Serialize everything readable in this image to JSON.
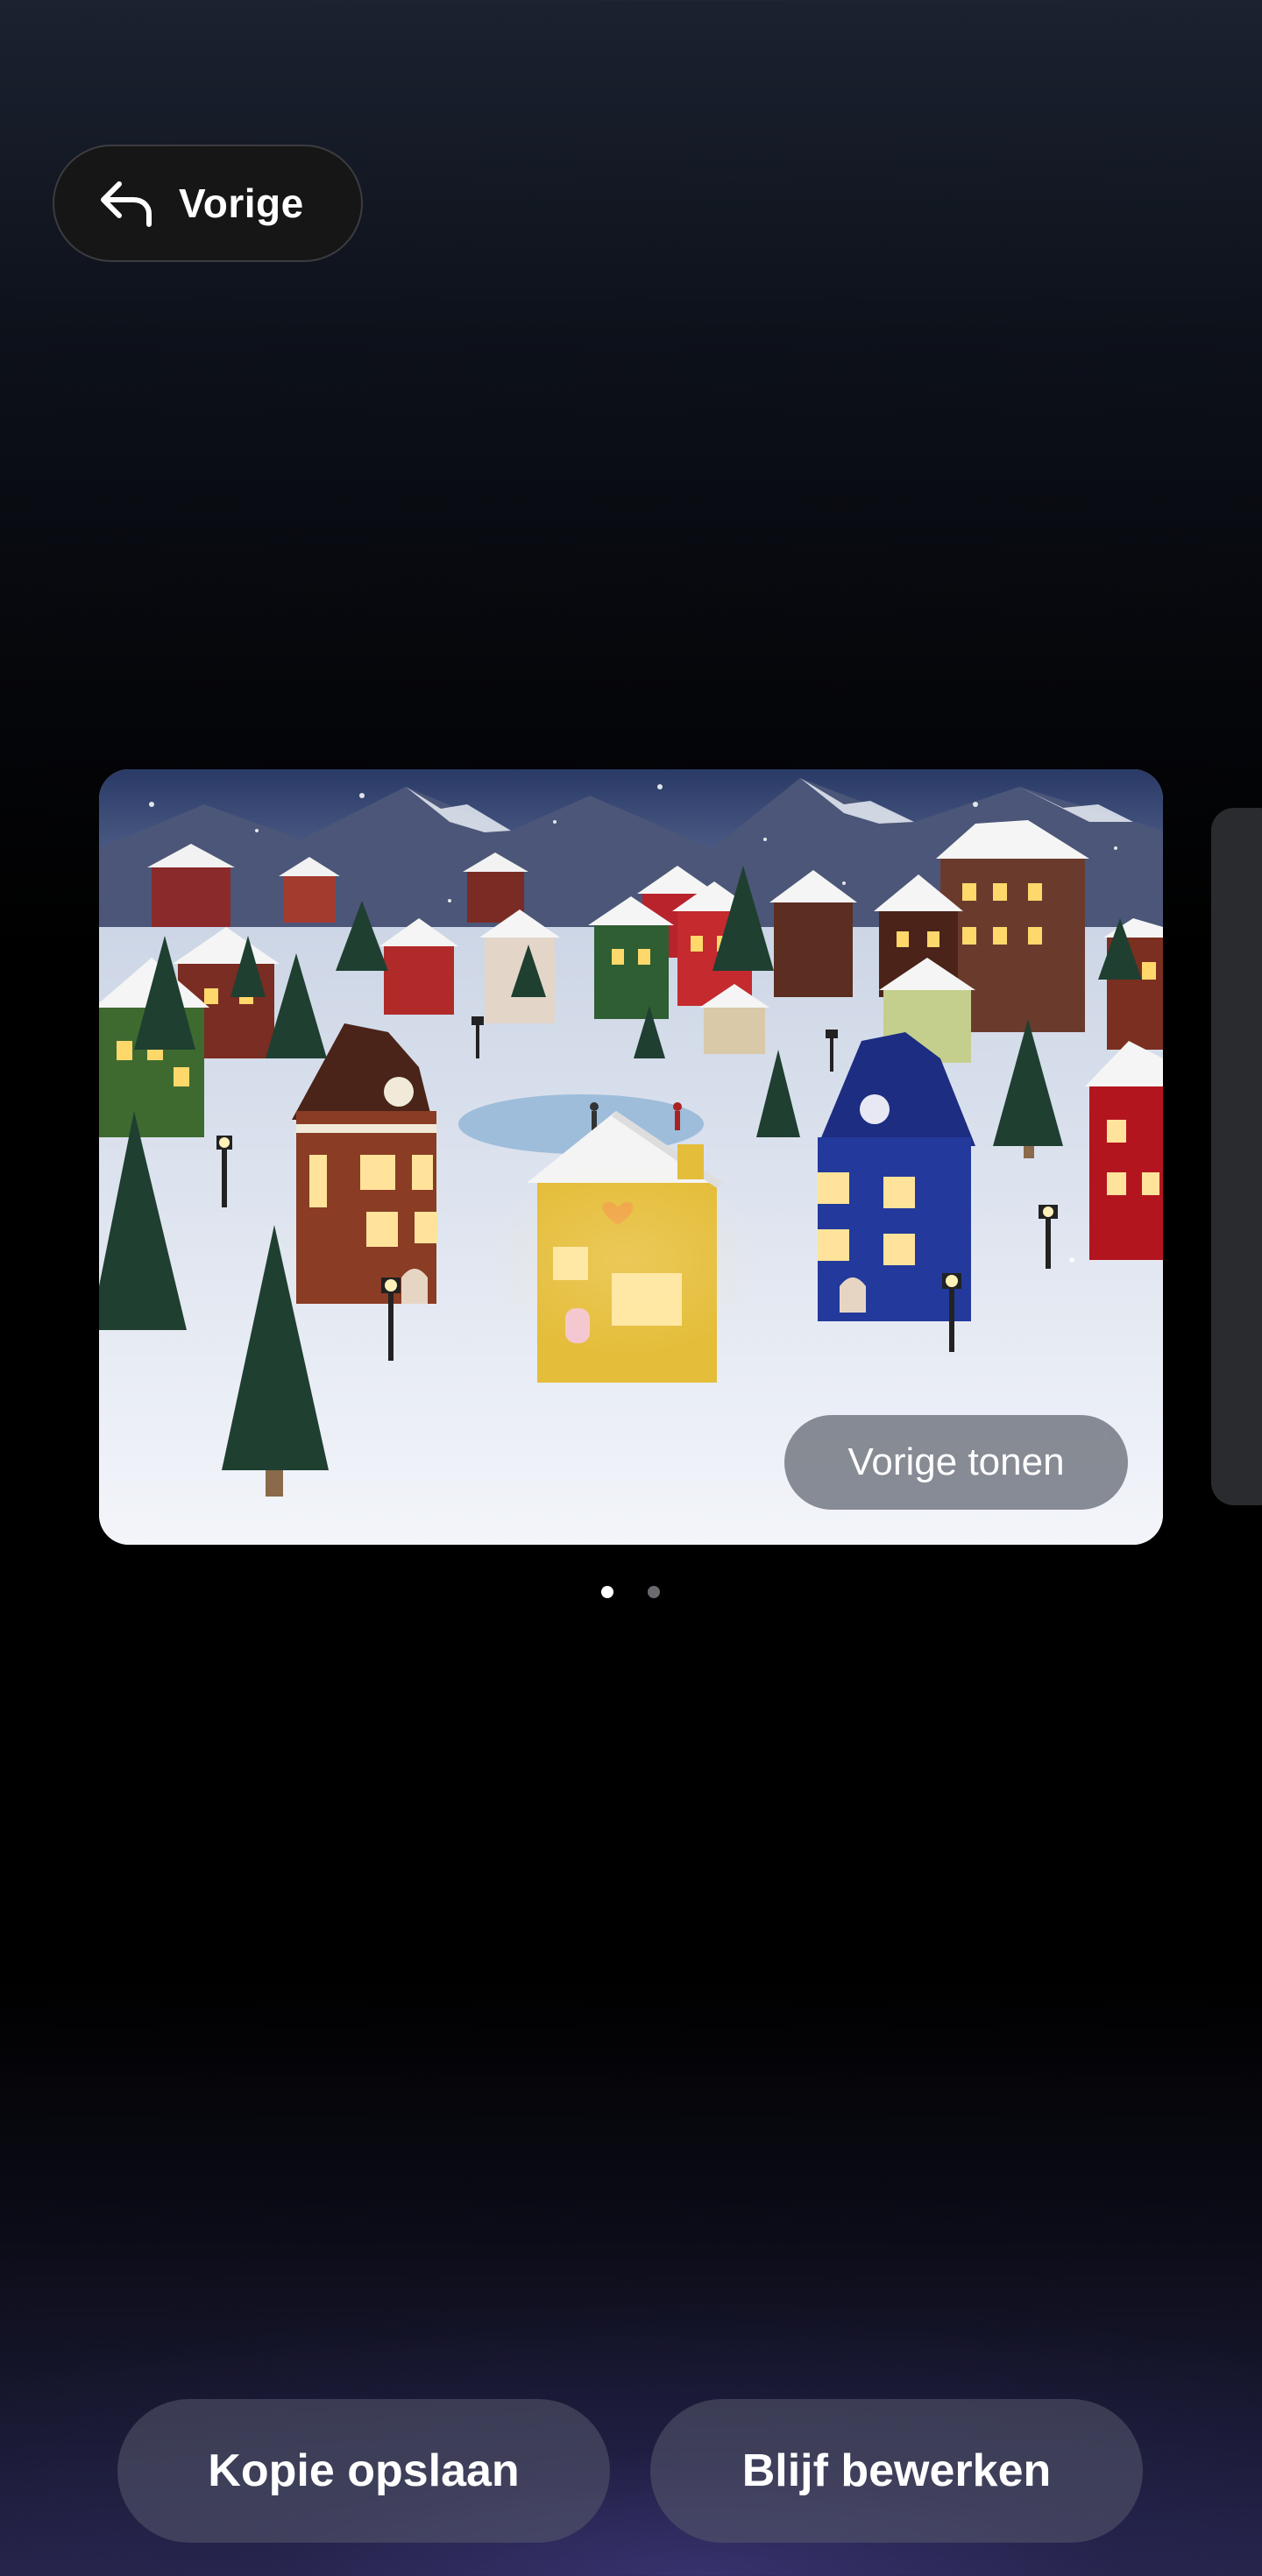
{
  "header": {
    "back_label": "Vorige"
  },
  "preview": {
    "show_previous_label": "Vorige tonen",
    "image_description_icon": "snowy-christmas-village-image",
    "pages_total": 2,
    "active_page": 1
  },
  "actions": {
    "save_copy_label": "Kopie opslaan",
    "keep_editing_label": "Blijf bewerken"
  },
  "colors": {
    "background_top": "#1b2230",
    "background_bottom": "#262448",
    "button_fill": "#585a6e",
    "back_button_fill": "#161617"
  }
}
